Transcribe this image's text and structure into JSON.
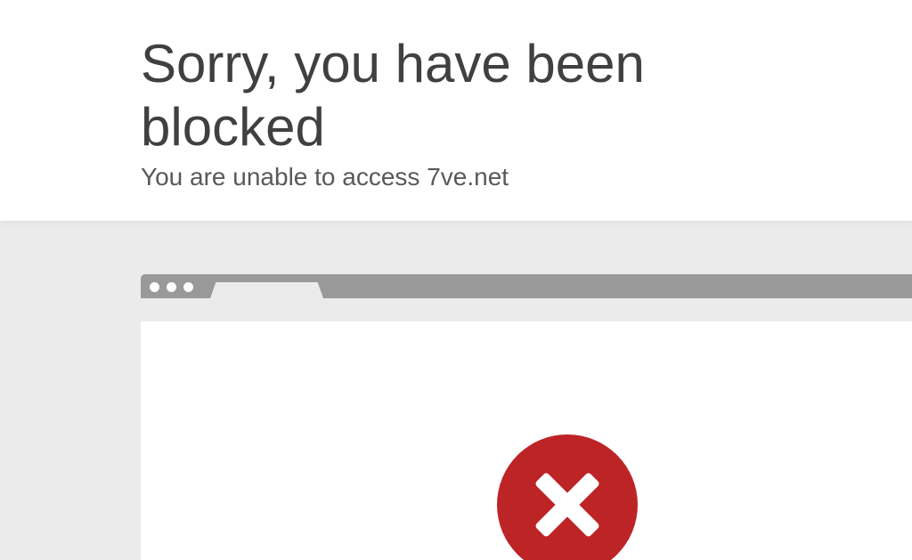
{
  "header": {
    "title": "Sorry, you have been blocked",
    "subtitle": "You are unable to access 7ve.net"
  },
  "illustration": {
    "browser_dots": 3,
    "error_icon": "close-icon",
    "colors": {
      "error_red": "#bd2426",
      "browser_bar": "#999999",
      "background_gray": "#ebebeb",
      "title_text": "#404040"
    }
  }
}
